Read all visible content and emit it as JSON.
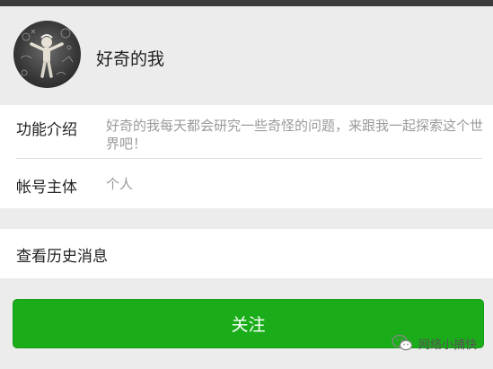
{
  "profile": {
    "name": "好奇的我"
  },
  "info": {
    "intro_label": "功能介绍",
    "intro_value": "好奇的我每天都会研究一些奇怪的问题，来跟我一起探索这个世界吧！",
    "account_label": "帐号主体",
    "account_value": "个人"
  },
  "history": {
    "label": "查看历史消息"
  },
  "actions": {
    "follow_label": "关注"
  },
  "watermark": {
    "text": "网络小捕快"
  },
  "colors": {
    "follow_button": "#1aad19",
    "page_background": "#ececec",
    "top_bar": "#3b3b3b"
  }
}
